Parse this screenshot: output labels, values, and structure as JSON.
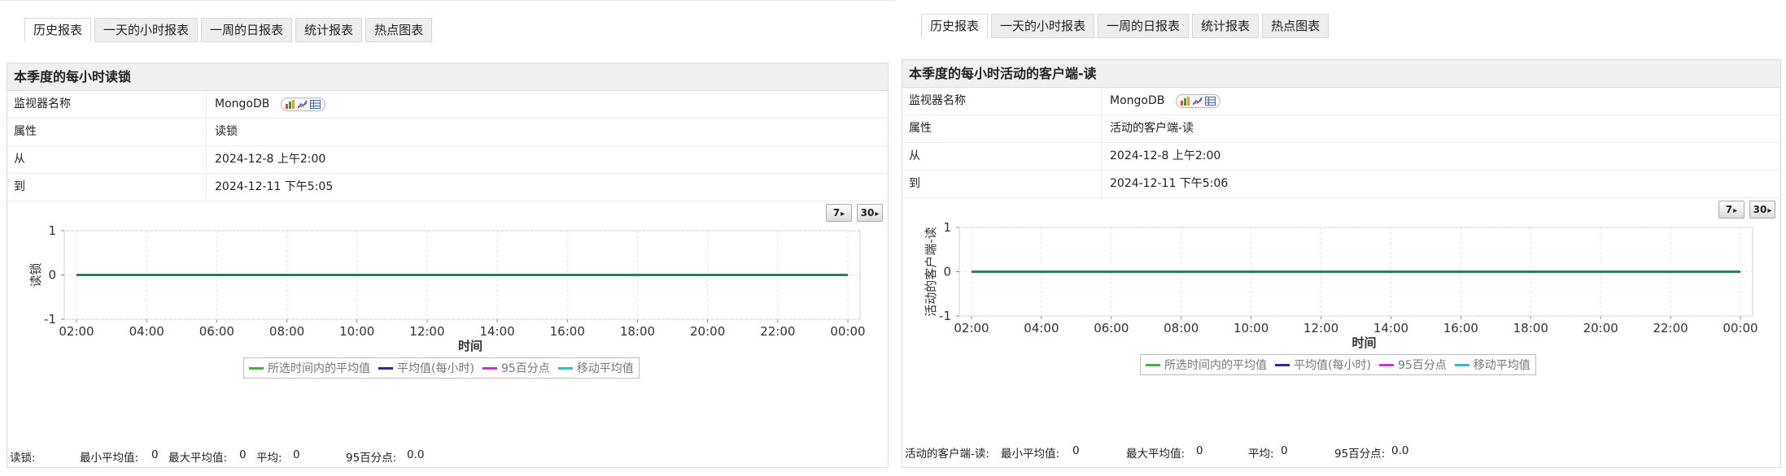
{
  "tabs": [
    "历史报表",
    "一天的小时报表",
    "一周的日报表",
    "统计报表",
    "热点图表"
  ],
  "colors": {
    "series_avg_selected": "#3cb44b",
    "series_hourly_avg": "#2a2aa0",
    "series_p95": "#cc33cc",
    "series_moving_avg": "#33bbcc",
    "plot_line": "#2e7d5b"
  },
  "legend": [
    "所选时间内的平均值",
    "平均值(每小时)",
    "95百分点",
    "移动平均值"
  ],
  "period_buttons": [
    "7",
    "30"
  ],
  "info_labels": {
    "monitor": "监视器名称",
    "attribute": "属性",
    "from": "从",
    "to": "到"
  },
  "left": {
    "title": "本季度的每小时读锁",
    "monitor_value": "MongoDB",
    "attribute_value": "读锁",
    "from_value": "2024-12-8 上午2:00",
    "to_value": "2024-12-11 下午5:05",
    "stats": {
      "label": "读锁:",
      "min_label": "最小平均值:",
      "min_value": "0",
      "max_label": "最大平均值:",
      "max_value": "0",
      "avg_label": "平均:",
      "avg_value": "0",
      "p95_label": "95百分点:",
      "p95_value": "0.0"
    }
  },
  "right": {
    "title": "本季度的每小时活动的客户端-读",
    "monitor_value": "MongoDB",
    "attribute_value": "活动的客户端-读",
    "from_value": "2024-12-8 上午2:00",
    "to_value": "2024-12-11 下午5:06",
    "stats": {
      "label": "活动的客户端-读:",
      "min_label": "最小平均值:",
      "min_value": "0",
      "max_label": "最大平均值:",
      "max_value": "0",
      "avg_label": "平均:",
      "avg_value": "0",
      "p95_label": "95百分点:",
      "p95_value": "0.0"
    }
  },
  "chart_data": [
    {
      "type": "line",
      "xlabel": "时间",
      "ylabel": "读锁",
      "x_ticks": [
        "02:00",
        "04:00",
        "06:00",
        "08:00",
        "10:00",
        "12:00",
        "14:00",
        "16:00",
        "18:00",
        "20:00",
        "22:00",
        "00:00"
      ],
      "y_ticks": [
        1,
        0,
        -1
      ],
      "ylim": [
        -1,
        1
      ],
      "grid": true,
      "legend_position": "bottom",
      "series": [
        {
          "name": "所选时间内的平均值",
          "x": [
            "02:00",
            "00:00"
          ],
          "values": [
            0,
            0
          ]
        }
      ]
    },
    {
      "type": "line",
      "xlabel": "时间",
      "ylabel": "活动的客户端-读",
      "x_ticks": [
        "02:00",
        "04:00",
        "06:00",
        "08:00",
        "10:00",
        "12:00",
        "14:00",
        "16:00",
        "18:00",
        "20:00",
        "22:00",
        "00:00"
      ],
      "y_ticks": [
        1,
        0,
        -1
      ],
      "ylim": [
        -1,
        1
      ],
      "grid": true,
      "legend_position": "bottom",
      "series": [
        {
          "name": "所选时间内的平均值",
          "x": [
            "02:00",
            "00:00"
          ],
          "values": [
            0,
            0
          ]
        }
      ]
    }
  ]
}
